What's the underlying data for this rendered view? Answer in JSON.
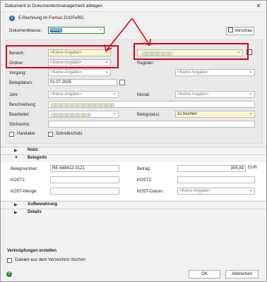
{
  "window": {
    "title": "Dokument in Dokumentenmanagement ablegen",
    "close": "✕"
  },
  "info": {
    "text": "E-Rechnung im Format ZUGFeRD."
  },
  "dokumentklasse": {
    "label": "Dokumentklasse:",
    "value": "Beleg"
  },
  "vorschau": {
    "label": "Vorschau"
  },
  "fields": {
    "bereich": {
      "label": "Bereich:",
      "value": "<Keine Angabe>"
    },
    "ordner": {
      "label": "Ordner:",
      "value": "<Keine Angabe>"
    },
    "vorgang": {
      "label": "Vorgang:",
      "value": "<Keine Angabe>"
    },
    "register": {
      "label": "Register:",
      "value": "<Keine Angabe>"
    },
    "belegdatum": {
      "label": "Belegdatum:",
      "value": "01.07.2025"
    },
    "jahr": {
      "label": "Jahr:",
      "value": "<Keine Angabe>"
    },
    "monat": {
      "label": "Monat:",
      "value": "<Keine Angabe>"
    },
    "beschreibung": {
      "label": "Beschreibung:"
    },
    "bearbeiter": {
      "label": "Bearbeiter:"
    },
    "belegstatus": {
      "label": "Belegstatus:",
      "value": "zu buchen"
    },
    "stichworte": {
      "label": "Stichworte:"
    },
    "right_top": {
      "value": "Inbox"
    }
  },
  "checks": {
    "handakte": "Handakte",
    "schreibschutz": "Schreibschutz"
  },
  "sections": {
    "notiz": "Notiz",
    "beleginfo": "Beleginfo",
    "aufbewahrung": "Aufbewahrung",
    "details": "Details"
  },
  "beleginfo": {
    "belegnummer_label": "Belegnummer:",
    "belegnummer_value": "RE-648412-0121",
    "kost1_label": "KOST1:",
    "kost_menge_label": "KOST-Menge:",
    "betrag_label": "Betrag:",
    "betrag_value": "305,83",
    "betrag_currency": "EUR",
    "kost2_label": "KOST2:",
    "kost_datum_label": "KOST-Datum:",
    "kost_datum_value": "<Keine Angabe>"
  },
  "verknuepfungen": {
    "title": "Verknüpfungen erstellen",
    "dateien": "Dateien aus dem Verzeichnis löschen"
  },
  "buttons": {
    "ok": "OK",
    "abbrechen": "Abbrechen"
  },
  "icons": [
    "info-icon",
    "preview-icon",
    "calendar-icon",
    "help-icon",
    "chevron-down-icon"
  ],
  "colors": {
    "highlight_box": "#d6001c",
    "required_field": "#fbf8cc",
    "accent": "#2a8a2a"
  }
}
